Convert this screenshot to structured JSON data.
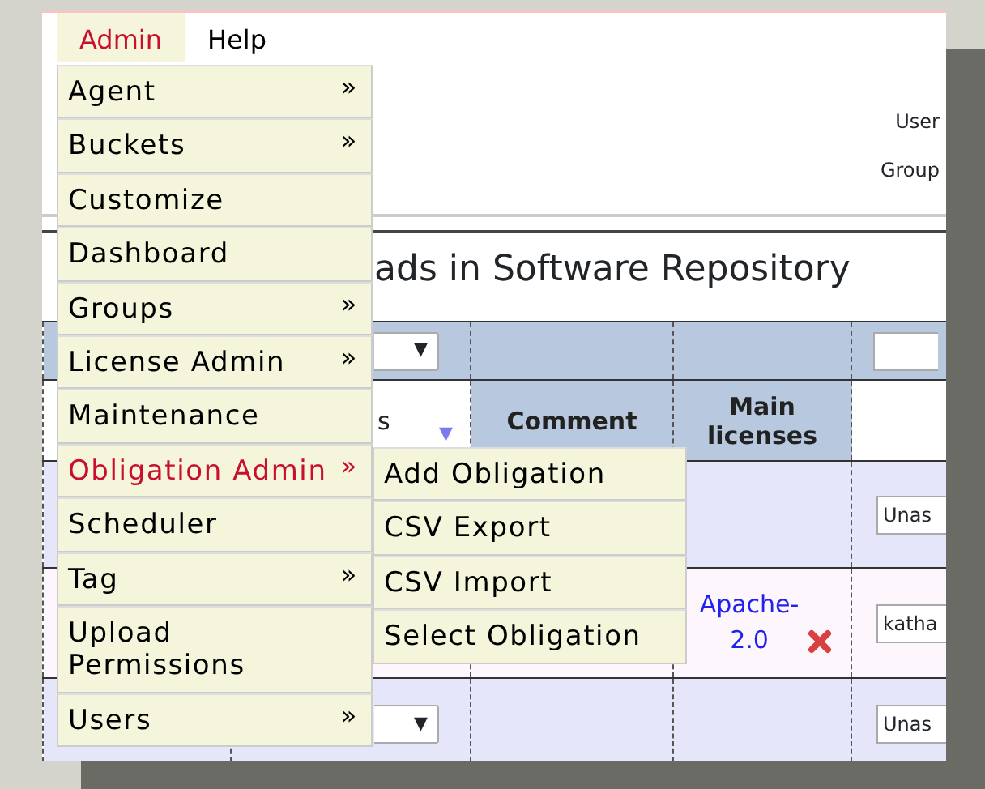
{
  "menubar": [
    {
      "label": "Admin",
      "selected": true
    },
    {
      "label": "Help",
      "selected": false
    }
  ],
  "admin_menu": [
    {
      "label": "Agent",
      "has_submenu": true,
      "selected": false
    },
    {
      "label": "Buckets",
      "has_submenu": true,
      "selected": false
    },
    {
      "label": "Customize",
      "has_submenu": false,
      "selected": false
    },
    {
      "label": "Dashboard",
      "has_submenu": false,
      "selected": false
    },
    {
      "label": "Groups",
      "has_submenu": true,
      "selected": false
    },
    {
      "label": "License Admin",
      "has_submenu": true,
      "selected": false
    },
    {
      "label": "Maintenance",
      "has_submenu": false,
      "selected": false
    },
    {
      "label": "Obligation Admin",
      "has_submenu": true,
      "selected": true
    },
    {
      "label": "Scheduler",
      "has_submenu": false,
      "selected": false
    },
    {
      "label": "Tag",
      "has_submenu": true,
      "selected": false
    },
    {
      "label": "Upload Permissions",
      "has_submenu": false,
      "selected": false
    },
    {
      "label": "Users",
      "has_submenu": true,
      "selected": false
    }
  ],
  "submenu_arrow": "»",
  "obligation_submenu": [
    "Add Obligation",
    "CSV Export",
    "CSV Import",
    "Select Obligation"
  ],
  "header": {
    "user_label": "User",
    "group_label": "Group"
  },
  "title": "ads in Software Repository",
  "table": {
    "columns": [
      {
        "label": "s",
        "sort_icon": "▼"
      },
      {
        "label": "Comment"
      },
      {
        "label": "Main licenses"
      }
    ],
    "filter_select_arrow": "▼",
    "rows": [
      {
        "assignee": "Unas"
      },
      {
        "license": "Apache-2.0",
        "removable": true,
        "assignee": "katha"
      },
      {
        "select_arrow": "▼",
        "assignee": "Unas"
      }
    ]
  }
}
